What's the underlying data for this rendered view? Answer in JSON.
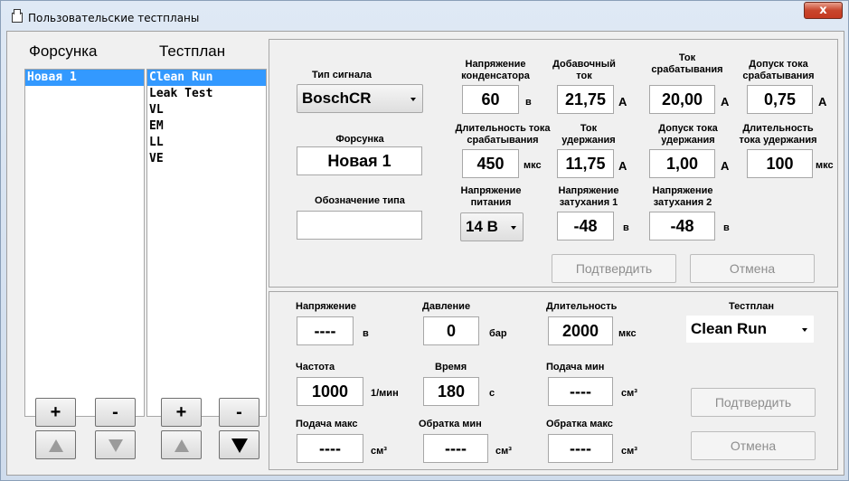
{
  "window": {
    "title": "Пользовательские тестпланы",
    "close_glyph": "x"
  },
  "injector_list": {
    "header": "Форсунка",
    "items": [
      "Новая 1"
    ],
    "selected": "Новая 1",
    "add": "+",
    "remove": "-"
  },
  "testplan_list": {
    "header": "Тестплан",
    "items": [
      "Clean Run",
      "Leak Test",
      "VL",
      "EM",
      "LL",
      "VE"
    ],
    "selected": "Clean Run",
    "add": "+",
    "remove": "-"
  },
  "injector_panel": {
    "signal_type": {
      "label": "Тип сигнала",
      "value": "BoschCR"
    },
    "injector": {
      "label": "Форсунка",
      "value": "Новая 1"
    },
    "type_designation": {
      "label": "Обозначение типа",
      "value": ""
    },
    "capacitor_voltage": {
      "label1": "Напряжение",
      "label2": "конденсатора",
      "value": "60",
      "unit": "в"
    },
    "additional_current": {
      "label1": "Добавочный",
      "label2": "ток",
      "value": "21,75",
      "unit": "А"
    },
    "trigger_current": {
      "label1": "Ток",
      "label2": "срабатывания",
      "value": "20,00",
      "unit": "А"
    },
    "trigger_current_tol": {
      "label1": "Допуск тока",
      "label2": "срабатывания",
      "value": "0,75",
      "unit": "А"
    },
    "trigger_duration": {
      "label1": "Длительность тока",
      "label2": "срабатывания",
      "value": "450",
      "unit": "мкс"
    },
    "hold_current": {
      "label1": "Ток",
      "label2": "удержания",
      "value": "11,75",
      "unit": "А"
    },
    "hold_current_tol": {
      "label1": "Допуск тока",
      "label2": "удержания",
      "value": "1,00",
      "unit": "А"
    },
    "hold_duration": {
      "label1": "Длительность",
      "label2": "тока удержания",
      "value": "100",
      "unit": "мкс"
    },
    "supply_voltage": {
      "label1": "Напряжение",
      "label2": "питания",
      "value": "14 В"
    },
    "decay_voltage_1": {
      "label1": "Напряжение",
      "label2": "затухания 1",
      "value": "-48",
      "unit": "в"
    },
    "decay_voltage_2": {
      "label1": "Напряжение",
      "label2": "затухания 2",
      "value": "-48",
      "unit": "в"
    },
    "confirm": "Подтвердить",
    "cancel": "Отмена"
  },
  "testplan_panel": {
    "voltage": {
      "label": "Напряжение",
      "value": "----",
      "unit": "в"
    },
    "pressure": {
      "label": "Давление",
      "value": "0",
      "unit": "бар"
    },
    "duration": {
      "label": "Длительность",
      "value": "2000",
      "unit": "мкс"
    },
    "testplan": {
      "label": "Тестплан",
      "value": "Clean Run"
    },
    "frequency": {
      "label": "Частота",
      "value": "1000",
      "unit": "1/мин"
    },
    "time": {
      "label": "Время",
      "value": "180",
      "unit": "с"
    },
    "feed_min": {
      "label": "Подача мин",
      "value": "----",
      "unit": "см³"
    },
    "feed_max": {
      "label": "Подача макс",
      "value": "----",
      "unit": "см³"
    },
    "return_min": {
      "label": "Обратка мин",
      "value": "----",
      "unit": "см³"
    },
    "return_max": {
      "label": "Обратка макс",
      "value": "----",
      "unit": "см³"
    },
    "confirm": "Подтвердить",
    "cancel": "Отмена"
  }
}
